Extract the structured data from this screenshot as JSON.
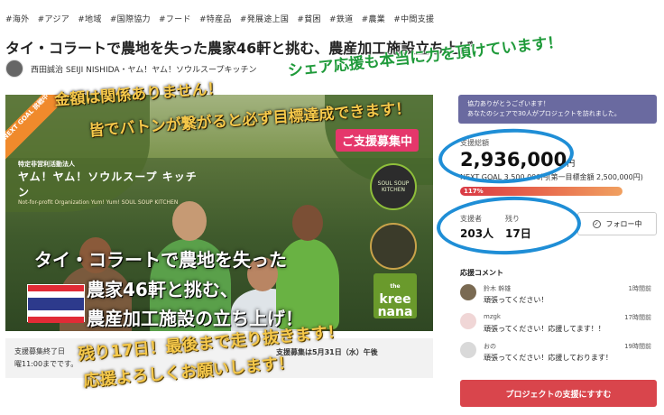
{
  "tags": [
    "#海外",
    "#アジア",
    "#地域",
    "#国際協力",
    "#フード",
    "#特産品",
    "#発展途上国",
    "#貧困",
    "#鉄道",
    "#農業",
    "#中間支援"
  ],
  "title": "タイ・コラートで農地を失った農家46軒と挑む、農産加工施設立ち上げ",
  "owner": "西田誠治 SEIJI NISHIDA・ヤム！ヤム！ソウルスープキッチン",
  "hero": {
    "ribbon": "NEXT GOAL 挑戦中",
    "npo_line1": "特定非営利活動法人",
    "npo_line2": "ヤム！ヤム！ソウルスープ キッチン",
    "npo_line3": "Not-for-profit Organization Yum! Yum! SOUL SOUP KITCHEN",
    "badge": "ご支援募集中",
    "logo_text": "SOUL SOUP KITCHEN",
    "kree_big": "kree nana",
    "kree_small": "the",
    "line1": "タイ・コラートで農地を失った",
    "line2": "農家46軒と挑む、",
    "line3": "農産加工施設の立ち上げ！"
  },
  "hero_bottom": {
    "left_line1": "支援募集終了日",
    "left_line2": "曜11:00までです。",
    "right": "支援募集は5月31日（水）午後"
  },
  "sidebar": {
    "banner_line1": "協力ありがとうございます！",
    "banner_line2": "あなたのシェアで30人がプロジェクトを訪れました。",
    "total_label": "支援総額",
    "total_value": "2,936,000",
    "total_unit": "円",
    "next_goal": "NEXT GOAL 3,500,000円(第一目標金額 2,500,000円)",
    "progress_label": "117%",
    "supporters_label": "支援者",
    "supporters_value": "203人",
    "remaining_label": "残り",
    "remaining_value": "17日",
    "follow_label": "フォロー中",
    "comments_heading": "応援コメント",
    "comments": [
      {
        "name": "鈴木 幹雄",
        "time": "1時間前",
        "text": "頑張ってください！"
      },
      {
        "name": "mzgk",
        "time": "17時間前",
        "text": "頑張ってください！応援してます！！"
      },
      {
        "name": "おの",
        "time": "19時間前",
        "text": "頑張ってください！応援しております！"
      }
    ],
    "cta": "プロジェクトの支援にすすむ"
  },
  "handwriting": {
    "green1": "シェア応援も本当に力を頂けています！",
    "green2": "金額は関係ありません！",
    "green3": "皆でバトンが繋がると必ず目標達成できます！",
    "yellow1": "残り17日！最後まで走り抜きます！",
    "yellow2": "応援よろしくお願いします！"
  },
  "colors": {
    "cta": "#d9454c",
    "badge": "#e5376b",
    "ring": "#1f8ed6",
    "banner": "#6a6aa0"
  }
}
